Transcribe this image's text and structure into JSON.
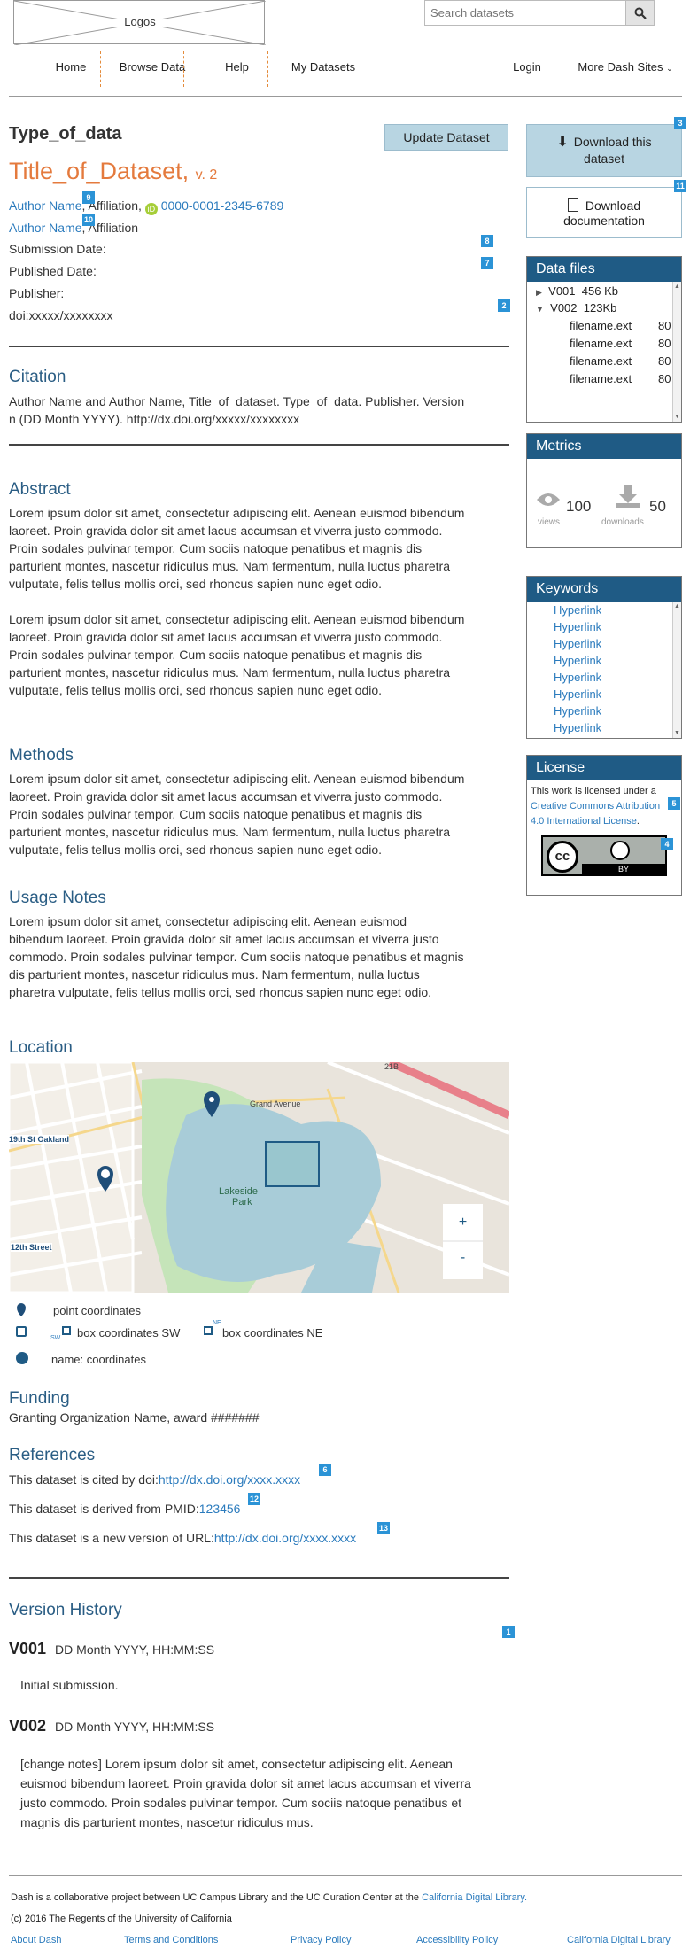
{
  "header": {
    "logo_text": "Logos",
    "search_placeholder": "Search datasets",
    "nav": [
      "Home",
      "Browse Data",
      "Help",
      "My Datasets",
      "Login",
      "More Dash Sites"
    ]
  },
  "dataset": {
    "type": "Type_of_data",
    "update_button": "Update Dataset",
    "title": "Title_of_Dataset,",
    "version": "v. 2",
    "author1_name": "Author Name",
    "author1_affil": ", Affiliation,",
    "orcid_badge": "iD",
    "orcid": "0000-0001-2345-6789",
    "author2_name": "Author Name",
    "author2_affil": ", Affiliation",
    "submission": "Submission Date:",
    "published": "Published Date:",
    "publisher": "Publisher:",
    "doi": "doi:xxxxx/xxxxxxxx"
  },
  "badges": {
    "b1": "1",
    "b2": "2",
    "b3": "3",
    "b4": "4",
    "b5": "5",
    "b6": "6",
    "b7": "7",
    "b8": "8",
    "b9": "9",
    "b10": "10",
    "b11": "11",
    "b12": "12",
    "b13": "13"
  },
  "citation": {
    "heading": "Citation",
    "line1": "Author Name and Author Name, Title_of_dataset. Type_of_data. Publisher. Version",
    "line2": "n (DD Month YYYY). http://dx.doi.org/xxxxx/xxxxxxxx"
  },
  "abstract": {
    "heading": "Abstract",
    "p1": [
      "Lorem ipsum dolor sit amet, consectetur adipiscing elit. Aenean euismod bibendum",
      "laoreet. Proin gravida dolor sit amet lacus accumsan et viverra justo commodo.",
      "Proin sodales pulvinar tempor. Cum sociis natoque penatibus et magnis dis",
      "parturient montes, nascetur ridiculus mus. Nam fermentum, nulla luctus pharetra",
      "vulputate, felis tellus mollis orci, sed rhoncus sapien nunc eget odio."
    ],
    "p2": [
      "Lorem ipsum dolor sit amet, consectetur adipiscing elit. Aenean euismod bibendum",
      "laoreet. Proin gravida dolor sit amet lacus accumsan et viverra justo commodo.",
      "Proin sodales pulvinar tempor. Cum sociis natoque penatibus et magnis dis",
      "parturient montes, nascetur ridiculus mus. Nam fermentum, nulla luctus pharetra",
      "vulputate, felis tellus mollis orci, sed rhoncus sapien nunc eget odio."
    ]
  },
  "methods": {
    "heading": "Methods",
    "p": [
      "Lorem ipsum dolor sit amet, consectetur adipiscing elit. Aenean euismod bibendum",
      "laoreet. Proin gravida dolor sit amet lacus accumsan et viverra justo commodo.",
      "Proin sodales pulvinar tempor. Cum sociis natoque penatibus et magnis dis",
      "parturient montes, nascetur ridiculus mus. Nam fermentum, nulla luctus pharetra",
      "vulputate, felis tellus mollis orci, sed rhoncus sapien nunc eget odio."
    ]
  },
  "usage": {
    "heading": "Usage Notes",
    "p": [
      "Lorem ipsum dolor sit amet, consectetur adipiscing elit. Aenean euismod",
      "bibendum laoreet. Proin gravida dolor sit amet lacus accumsan et viverra justo",
      "commodo. Proin sodales pulvinar tempor. Cum sociis natoque penatibus et magnis",
      "dis parturient montes, nascetur ridiculus mus. Nam fermentum, nulla luctus",
      "pharetra vulputate, felis tellus mollis orci, sed rhoncus sapien nunc eget odio."
    ]
  },
  "location": {
    "heading": "Location",
    "map_labels": {
      "oakland": "19th St Oakland",
      "twelfth": "12th Street",
      "park": "Lakeside",
      "park2": "Park",
      "grand": "Grand Avenue",
      "ave": "21B"
    },
    "zoom_in": "+",
    "zoom_out": "-",
    "legend_point": "point coordinates",
    "legend_box": "box coordinates SW",
    "legend_box_ne": "box coordinates NE",
    "sw": "SW",
    "ne": "NE",
    "legend_name": "name: coordinates"
  },
  "funding": {
    "heading": "Funding",
    "text": "Granting Organization Name, award #######"
  },
  "references": {
    "heading": "References",
    "r1_pre": "This dataset is cited by doi:",
    "r1_link": "http://dx.doi.org/xxxx.xxxx",
    "r2_pre": "This dataset is derived from PMID:",
    "r2_link": "123456",
    "r3_pre": "This dataset is a new version of  URL:",
    "r3_link": "http://dx.doi.org/xxxx.xxxx"
  },
  "versions": {
    "heading": "Version History",
    "v1": "V001",
    "v1_date": "DD Month YYYY, HH:MM:SS",
    "v1_note": "Initial submission.",
    "v2": "V002",
    "v2_date": "DD Month YYYY, HH:MM:SS",
    "v2_note": [
      "[change notes] Lorem ipsum dolor sit amet, consectetur adipiscing elit. Aenean",
      "euismod bibendum laoreet. Proin gravida dolor sit amet lacus accumsan et viverra",
      "justo commodo. Proin sodales pulvinar tempor. Cum sociis natoque penatibus et",
      "magnis dis parturient montes, nascetur ridiculus mus."
    ]
  },
  "sidebar": {
    "download": [
      "Download this",
      "dataset"
    ],
    "documentation": [
      "Download",
      "documentation"
    ],
    "files_heading": "Data files",
    "files": [
      {
        "name": "V001",
        "size": "456 Kb"
      },
      {
        "name": "V002",
        "size": "123Kb"
      }
    ],
    "subfiles": [
      "filename.ext",
      "filename.ext",
      "filename.ext",
      "filename.ext"
    ],
    "subsize": "80",
    "metrics_heading": "Metrics",
    "views": "100",
    "views_label": "views",
    "downloads": "50",
    "downloads_label": "downloads",
    "keywords_heading": "Keywords",
    "keywords": [
      "Hyperlink",
      "Hyperlink",
      "Hyperlink",
      "Hyperlink",
      "Hyperlink",
      "Hyperlink",
      "Hyperlink",
      "Hyperlink"
    ],
    "license_heading": "License",
    "license_pre": "This work is licensed under a",
    "license_link1": "Creative Commons Attribution",
    "license_link2": "4.0 International License",
    "license_post": ".",
    "cc_by": "BY"
  },
  "footer": {
    "text_pre": "Dash is a collaborative project between UC Campus Library and the UC Curation Center at the",
    "text_link": "California Digital Library.",
    "copyright": "(c) 2016 The Regents of the University of California",
    "links": [
      "About Dash",
      "Terms and Conditions",
      "Privacy Policy",
      "Accessibility Policy",
      "California Digital Library"
    ]
  }
}
